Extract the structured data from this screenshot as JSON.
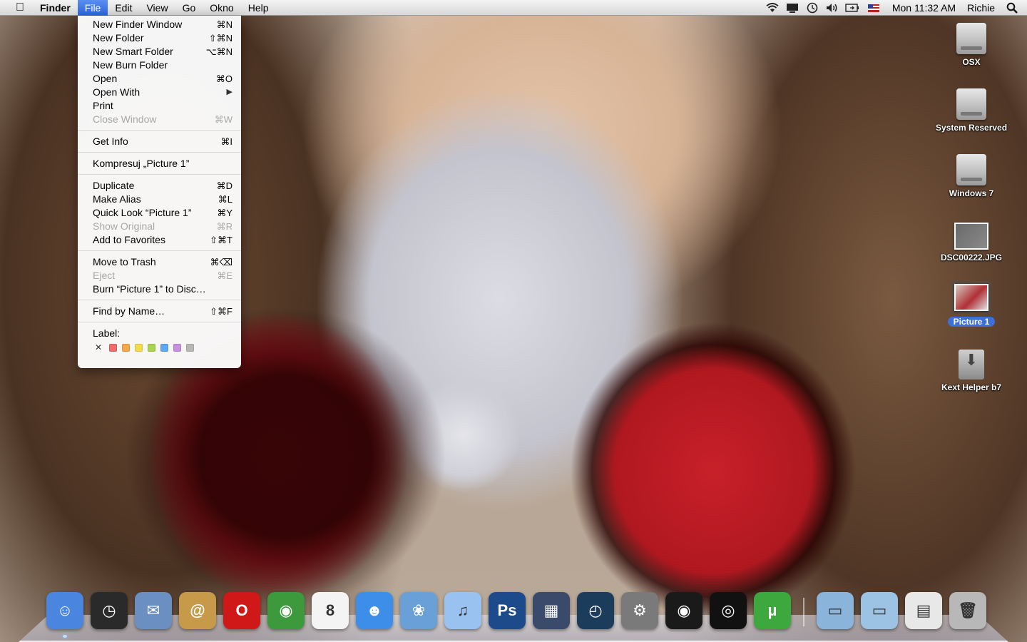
{
  "menubar": {
    "apple": "",
    "app_name": "Finder",
    "menus": [
      "File",
      "Edit",
      "View",
      "Go",
      "Okno",
      "Help"
    ],
    "active_menu": "File",
    "clock": "Mon 11:32 AM",
    "user": "Richie",
    "status_icons": [
      "wifi-icon",
      "display-icon",
      "time-machine-icon",
      "volume-icon",
      "battery-icon",
      "input-flag-icon",
      "spotlight-icon"
    ]
  },
  "file_menu": {
    "groups": [
      [
        {
          "label": "New Finder Window",
          "shortcut": "⌘N",
          "enabled": true
        },
        {
          "label": "New Folder",
          "shortcut": "⇧⌘N",
          "enabled": true
        },
        {
          "label": "New Smart Folder",
          "shortcut": "⌥⌘N",
          "enabled": true
        },
        {
          "label": "New Burn Folder",
          "shortcut": "",
          "enabled": true
        },
        {
          "label": "Open",
          "shortcut": "⌘O",
          "enabled": true
        },
        {
          "label": "Open With",
          "shortcut": "▶",
          "enabled": true
        },
        {
          "label": "Print",
          "shortcut": "",
          "enabled": true
        },
        {
          "label": "Close Window",
          "shortcut": "⌘W",
          "enabled": false
        }
      ],
      [
        {
          "label": "Get Info",
          "shortcut": "⌘I",
          "enabled": true
        }
      ],
      [
        {
          "label": "Kompresuj „Picture 1”",
          "shortcut": "",
          "enabled": true
        }
      ],
      [
        {
          "label": "Duplicate",
          "shortcut": "⌘D",
          "enabled": true
        },
        {
          "label": "Make Alias",
          "shortcut": "⌘L",
          "enabled": true
        },
        {
          "label": "Quick Look “Picture 1”",
          "shortcut": "⌘Y",
          "enabled": true
        },
        {
          "label": "Show Original",
          "shortcut": "⌘R",
          "enabled": false
        },
        {
          "label": "Add to Favorites",
          "shortcut": "⇧⌘T",
          "enabled": true
        }
      ],
      [
        {
          "label": "Move to Trash",
          "shortcut": "⌘⌫",
          "enabled": true
        },
        {
          "label": "Eject",
          "shortcut": "⌘E",
          "enabled": false
        },
        {
          "label": "Burn “Picture 1” to Disc…",
          "shortcut": "",
          "enabled": true
        }
      ],
      [
        {
          "label": "Find by Name…",
          "shortcut": "⇧⌘F",
          "enabled": true
        }
      ]
    ],
    "label_heading": "Label:",
    "label_none": "✕",
    "label_colors": [
      "#f26b6b",
      "#f5a94b",
      "#f2dc4e",
      "#a6d44c",
      "#5ea8f2",
      "#c98fe0",
      "#b7b7b7"
    ]
  },
  "desktop_icons": [
    {
      "label": "OSX",
      "kind": "disk",
      "selected": false
    },
    {
      "label": "System Reserved",
      "kind": "disk",
      "selected": false
    },
    {
      "label": "Windows 7",
      "kind": "disk",
      "selected": false
    },
    {
      "label": "DSC00222.JPG",
      "kind": "image",
      "selected": false
    },
    {
      "label": "Picture 1",
      "kind": "image",
      "selected": true
    },
    {
      "label": "Kext Helper b7",
      "kind": "package",
      "selected": false
    }
  ],
  "dock": {
    "apps": [
      {
        "name": "finder-icon",
        "color": "#4a86e0",
        "glyph": "☺",
        "running": true
      },
      {
        "name": "dashboard-icon",
        "color": "#2a2a2a",
        "glyph": "◷",
        "running": false
      },
      {
        "name": "mail-icon",
        "color": "#6a8fc0",
        "glyph": "✉",
        "running": false
      },
      {
        "name": "address-book-icon",
        "color": "#c79a4a",
        "glyph": "@",
        "running": false
      },
      {
        "name": "opera-icon",
        "color": "#d01818",
        "glyph": "O",
        "running": false
      },
      {
        "name": "chrome-icon",
        "color": "#3c9a3c",
        "glyph": "◉",
        "running": false
      },
      {
        "name": "ical-icon",
        "color": "#f4f4f4",
        "glyph": "8",
        "running": false
      },
      {
        "name": "messenger-icon",
        "color": "#3d8ee8",
        "glyph": "☻",
        "running": false
      },
      {
        "name": "iphoto-icon",
        "color": "#6aa0d8",
        "glyph": "❀",
        "running": false
      },
      {
        "name": "itunes-icon",
        "color": "#9ac2f0",
        "glyph": "♫",
        "running": false
      },
      {
        "name": "photoshop-icon",
        "color": "#1c4a8a",
        "glyph": "Ps",
        "running": false
      },
      {
        "name": "spaces-icon",
        "color": "#3a4a6a",
        "glyph": "▦",
        "running": false
      },
      {
        "name": "time-machine-icon",
        "color": "#1c3c5c",
        "glyph": "◴",
        "running": false
      },
      {
        "name": "system-preferences-icon",
        "color": "#7a7a7a",
        "glyph": "⚙",
        "running": false
      },
      {
        "name": "music-player-icon",
        "color": "#1a1a1a",
        "glyph": "◉",
        "running": false
      },
      {
        "name": "record-player-icon",
        "color": "#111111",
        "glyph": "◎",
        "running": false
      },
      {
        "name": "utorrent-icon",
        "color": "#3da83d",
        "glyph": "µ",
        "running": false
      }
    ],
    "stacks": [
      {
        "name": "applications-folder-icon",
        "color": "#8ab4da",
        "glyph": "▭"
      },
      {
        "name": "documents-folder-icon",
        "color": "#9cc2e4",
        "glyph": "▭"
      },
      {
        "name": "downloads-stack-icon",
        "color": "#e8e8e8",
        "glyph": "▤"
      },
      {
        "name": "trash-icon",
        "color": "#b8b8b8",
        "glyph": "🗑"
      }
    ]
  }
}
